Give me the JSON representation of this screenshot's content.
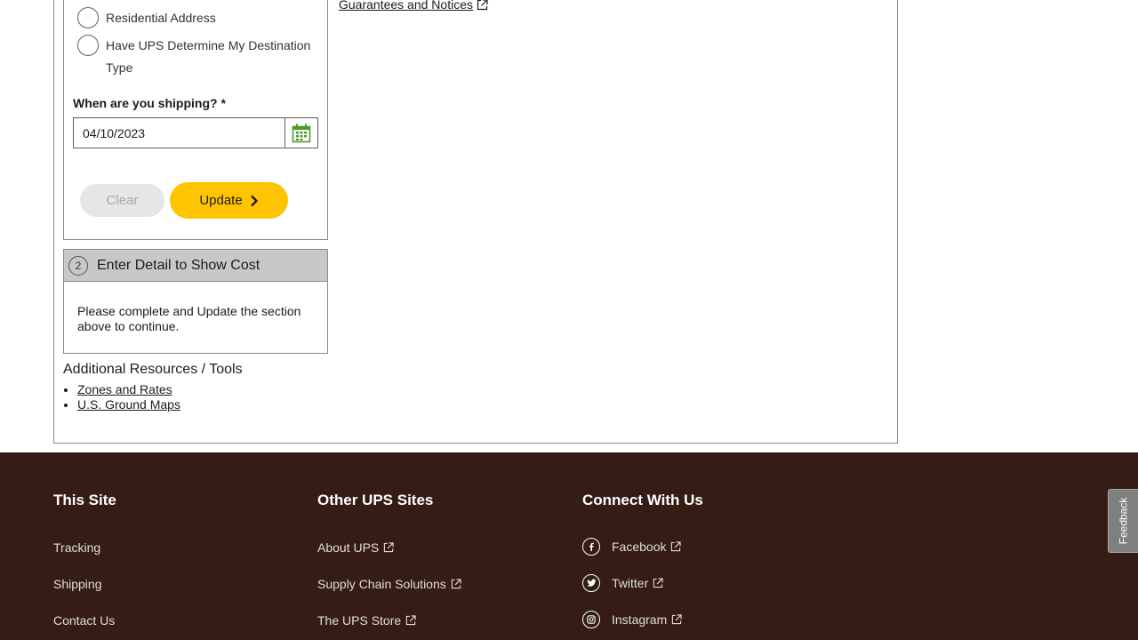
{
  "destination": {
    "options": [
      {
        "label": "Residential Address"
      },
      {
        "label": "Have UPS Determine My Destination Type"
      }
    ]
  },
  "shipping_date": {
    "label": "When are you shipping? *",
    "value": "04/10/2023",
    "calendar_icon": "calendar-icon"
  },
  "buttons": {
    "clear": "Clear",
    "update": "Update"
  },
  "step2": {
    "number": "2",
    "title": "Enter Detail to Show Cost",
    "body": "Please complete and Update the section above to continue."
  },
  "resources": {
    "title": "Additional Resources / Tools",
    "links": [
      "Zones and Rates",
      "U.S. Ground Maps"
    ]
  },
  "guarantees_link": "Guarantees and Notices",
  "footer": {
    "this_site": {
      "title": "This Site",
      "links": [
        "Tracking",
        "Shipping",
        "Contact Us"
      ]
    },
    "other_sites": {
      "title": "Other UPS Sites",
      "links": [
        "About UPS",
        "Supply Chain Solutions",
        "The UPS Store"
      ]
    },
    "connect": {
      "title": "Connect With Us",
      "links": [
        "Facebook",
        "Twitter",
        "Instagram"
      ]
    },
    "background_color": "#351c15"
  },
  "feedback_tab": "Feedback",
  "colors": {
    "accent_yellow": "#ffc400",
    "calendar_green": "#4e9a2b"
  }
}
